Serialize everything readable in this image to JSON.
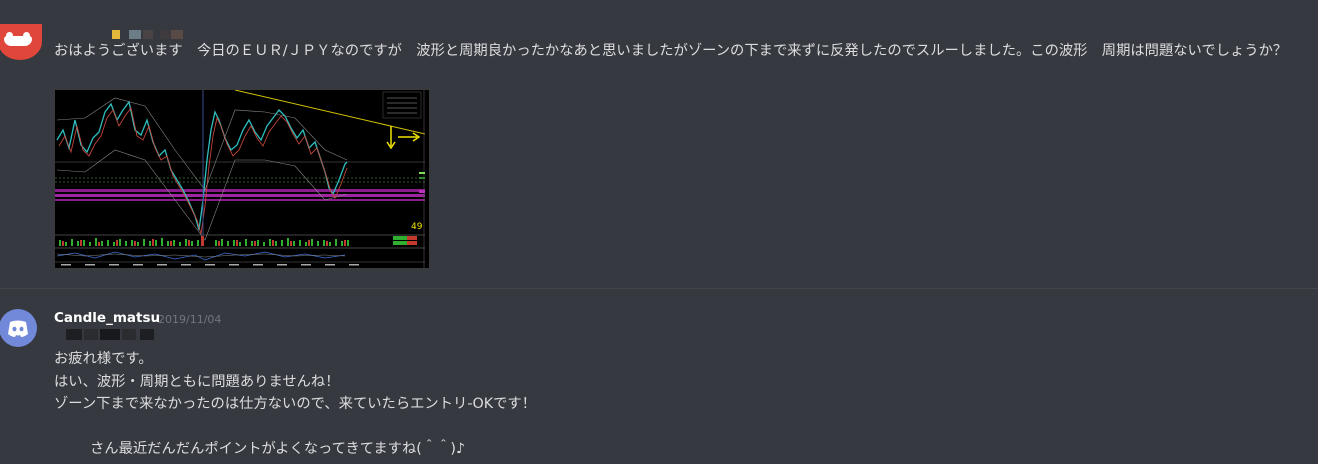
{
  "messages": [
    {
      "text": "おはようございます　今日のＥＵＲ/ＪＰＹなのですが　波形と周期良かったかなあと思いましたがゾーンの下まで来ずに反発したのでスルーしました。この波形　周期は問題ないでしょうか？",
      "attachment": {
        "type": "chart-screenshot",
        "overlay_number": "49"
      }
    },
    {
      "author": "Candle_matsu",
      "timestamp": "2019/11/04",
      "lines": [
        "お疲れ様です。",
        "はい、波形・周期ともに問題ありませんね！",
        "ゾーン下まで来なかったのは仕方ないので、来ていたらエントリ-OKです！",
        "",
        "さん最近だんだんポイントがよくなってきてますね(＾＾)♪"
      ]
    }
  ],
  "colors": {
    "background": "#36393f",
    "text": "#dcddde",
    "username": "#ffffff",
    "timestamp": "#72767d",
    "discord_blurple": "#7289da",
    "avatar_red": "#e0463a",
    "chart_arrow": "#f2e600"
  }
}
